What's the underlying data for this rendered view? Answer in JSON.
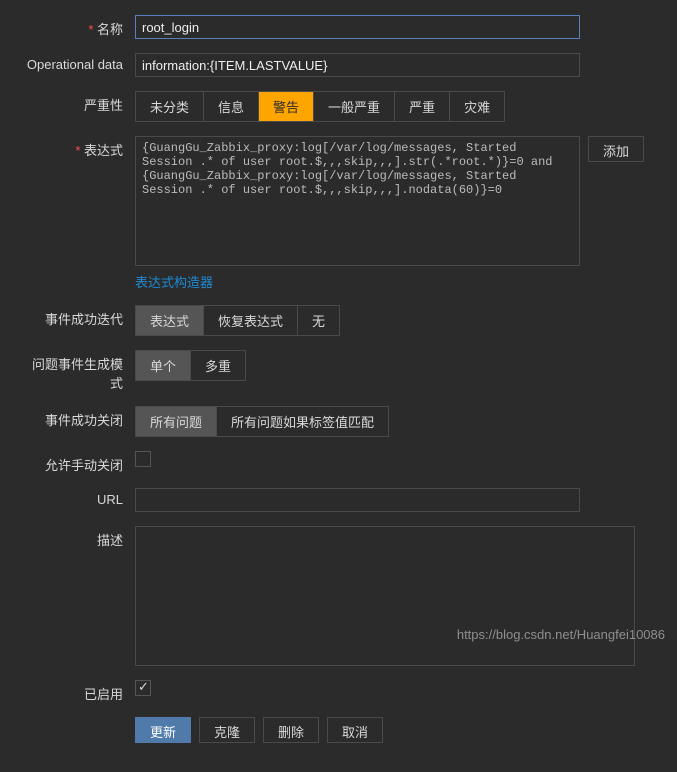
{
  "fields": {
    "name": {
      "label": "名称",
      "value": "root_login"
    },
    "operational_data": {
      "label": "Operational data",
      "value": "information:{ITEM.LASTVALUE}"
    },
    "severity": {
      "label": "严重性",
      "options": [
        "未分类",
        "信息",
        "警告",
        "一般严重",
        "严重",
        "灾难"
      ],
      "active_index": 2
    },
    "expression": {
      "label": "表达式",
      "value": "{GuangGu_Zabbix_proxy:log[/var/log/messages, Started Session .* of user root.$,,,skip,,,].str(.*root.*)}=0 and {GuangGu_Zabbix_proxy:log[/var/log/messages, Started Session .* of user root.$,,,skip,,,].nodata(60)}=0",
      "add_btn": "添加",
      "builder_link": "表达式构造器"
    },
    "event_ok_iter": {
      "label": "事件成功迭代",
      "options": [
        "表达式",
        "恢复表达式",
        "无"
      ],
      "active_index": 0
    },
    "problem_gen_mode": {
      "label": "问题事件生成模式",
      "options": [
        "单个",
        "多重"
      ],
      "active_index": 0
    },
    "event_ok_close": {
      "label": "事件成功关闭",
      "options": [
        "所有问题",
        "所有问题如果标签值匹配"
      ],
      "active_index": 0
    },
    "allow_manual_close": {
      "label": "允许手动关闭",
      "checked": false
    },
    "url": {
      "label": "URL",
      "value": ""
    },
    "description": {
      "label": "描述",
      "value": ""
    },
    "enabled": {
      "label": "已启用",
      "checked": true
    }
  },
  "actions": {
    "update": "更新",
    "clone": "克隆",
    "delete": "删除",
    "cancel": "取消"
  },
  "watermark": "https://blog.csdn.net/Huangfei10086"
}
